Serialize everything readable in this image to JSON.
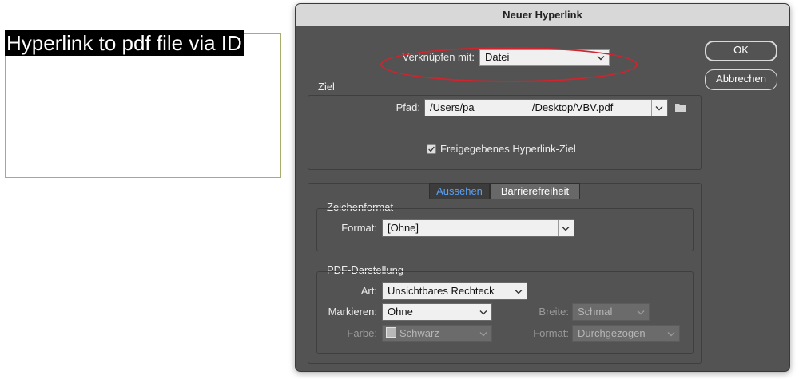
{
  "document": {
    "text": "Hyperlink to pdf file via ID"
  },
  "dialog": {
    "title": "Neuer Hyperlink",
    "link_with_label": "Verknüpfen mit:",
    "link_with_value": "Datei",
    "ok_label": "OK",
    "cancel_label": "Abbrechen",
    "target": {
      "group_title": "Ziel",
      "path_label": "Pfad:",
      "path_value": "/Users/pa                    /Desktop/VBV.pdf",
      "shared_label": "Freigegebenes Hyperlink-Ziel",
      "shared_checked": true
    },
    "tabs": [
      {
        "label": "Aussehen",
        "active": true
      },
      {
        "label": "Barrierefreiheit",
        "active": false
      }
    ],
    "char_format": {
      "group_title": "Zeichenformat",
      "format_label": "Format:",
      "format_value": "[Ohne]"
    },
    "pdf_display": {
      "group_title": "PDF-Darstellung",
      "type_label": "Art:",
      "type_value": "Unsichtbares Rechteck",
      "highlight_label": "Markieren:",
      "highlight_value": "Ohne",
      "width_label": "Breite:",
      "width_value": "Schmal",
      "color_label": "Farbe:",
      "color_value": "Schwarz",
      "style_label": "Format:",
      "style_value": "Durchgezogen"
    }
  },
  "colors": {
    "dialog_bg": "#535353",
    "accent": "#5e9cf0",
    "annotation": "#d0242e"
  }
}
